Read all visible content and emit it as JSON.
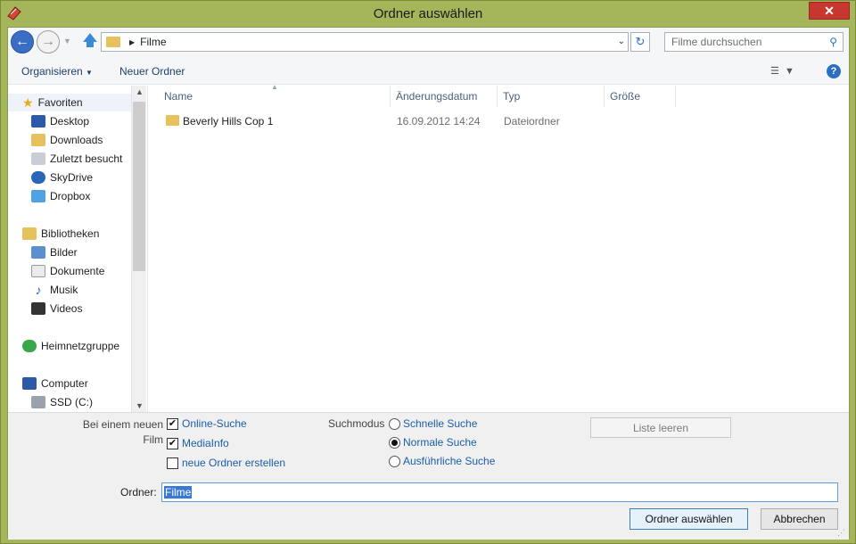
{
  "window": {
    "title": "Ordner auswählen",
    "close_label": "✕"
  },
  "address": {
    "path": "Filme"
  },
  "search": {
    "placeholder": "Filme durchsuchen"
  },
  "toolbar": {
    "organize_label": "Organisieren",
    "new_folder_label": "Neuer Ordner"
  },
  "sidebar": {
    "favorites": {
      "label": "Favoriten"
    },
    "favorite_items": [
      {
        "label": "Desktop",
        "icon": "desktop-icon"
      },
      {
        "label": "Downloads",
        "icon": "downloads-icon"
      },
      {
        "label": "Zuletzt besucht",
        "icon": "recent-places-icon"
      },
      {
        "label": "SkyDrive",
        "icon": "skydrive-icon"
      },
      {
        "label": "Dropbox",
        "icon": "dropbox-icon"
      }
    ],
    "libraries": {
      "label": "Bibliotheken"
    },
    "library_items": [
      {
        "label": "Bilder",
        "icon": "pictures-icon"
      },
      {
        "label": "Dokumente",
        "icon": "documents-icon"
      },
      {
        "label": "Musik",
        "icon": "music-icon"
      },
      {
        "label": "Videos",
        "icon": "videos-icon"
      }
    ],
    "homegroup": {
      "label": "Heimnetzgruppe"
    },
    "computer": {
      "label": "Computer"
    },
    "computer_items": [
      {
        "label": "SSD (C:)",
        "icon": "drive-icon"
      }
    ]
  },
  "files": {
    "columns": [
      "Name",
      "Änderungsdatum",
      "Typ",
      "Größe"
    ],
    "rows": [
      {
        "name": "Beverly Hills Cop 1",
        "date": "16.09.2012 14:24",
        "type": "Dateiordner",
        "size": ""
      }
    ]
  },
  "options": {
    "new_film_label": "Bei einem neuen Film",
    "checkboxes": [
      {
        "label": "Online-Suche",
        "checked": true
      },
      {
        "label": "MediaInfo",
        "checked": true
      },
      {
        "label": "neue Ordner erstellen",
        "checked": false
      }
    ],
    "search_mode_label": "Suchmodus",
    "radios": [
      {
        "label": "Schnelle Suche",
        "selected": false
      },
      {
        "label": "Normale Suche",
        "selected": true
      },
      {
        "label": "Ausführliche Suche",
        "selected": false
      }
    ],
    "clear_list_label": "Liste leeren",
    "folder_label": "Ordner:",
    "folder_value": "Filme"
  },
  "buttons": {
    "select_folder_label": "Ordner auswählen",
    "cancel_label": "Abbrechen"
  },
  "colors": {
    "frame": "#a5b55a",
    "accent": "#2b6fc2",
    "close": "#c7372f"
  }
}
